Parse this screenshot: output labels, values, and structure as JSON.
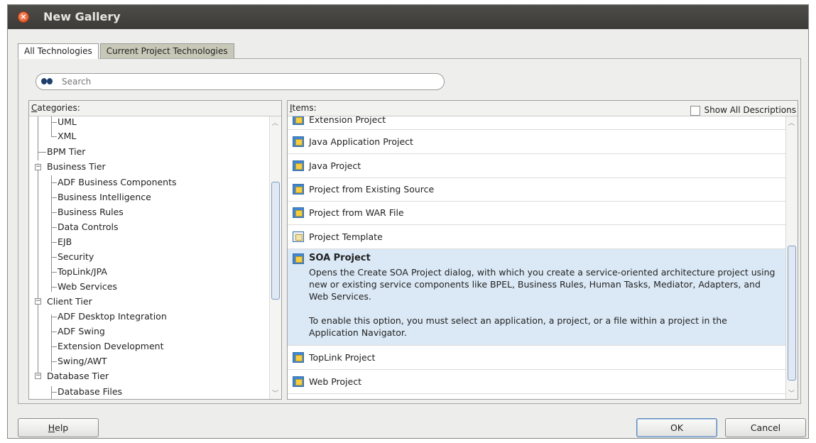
{
  "window": {
    "title": "New Gallery"
  },
  "tabs": [
    {
      "label": "All Technologies",
      "active": true
    },
    {
      "label": "Current Project Technologies",
      "active": false
    }
  ],
  "search": {
    "placeholder": "Search",
    "value": ""
  },
  "categories": {
    "header": "Categories:",
    "items": [
      {
        "label": "UML",
        "level": 1
      },
      {
        "label": "XML",
        "level": 1
      },
      {
        "label": "BPM Tier",
        "level": 0
      },
      {
        "label": "Business Tier",
        "level": 0,
        "expanded": true
      },
      {
        "label": "ADF Business Components",
        "level": 1
      },
      {
        "label": "Business Intelligence",
        "level": 1
      },
      {
        "label": "Business Rules",
        "level": 1
      },
      {
        "label": "Data Controls",
        "level": 1
      },
      {
        "label": "EJB",
        "level": 1
      },
      {
        "label": "Security",
        "level": 1
      },
      {
        "label": "TopLink/JPA",
        "level": 1
      },
      {
        "label": "Web Services",
        "level": 1
      },
      {
        "label": "Client Tier",
        "level": 0,
        "expanded": true
      },
      {
        "label": "ADF Desktop Integration",
        "level": 1
      },
      {
        "label": "ADF Swing",
        "level": 1
      },
      {
        "label": "Extension Development",
        "level": 1
      },
      {
        "label": "Swing/AWT",
        "level": 1
      },
      {
        "label": "Database Tier",
        "level": 0,
        "expanded": true
      },
      {
        "label": "Database Files",
        "level": 1
      }
    ]
  },
  "items_pane": {
    "header": "Items:",
    "show_all_label": "Show All Descriptions",
    "show_all_checked": false,
    "items": [
      {
        "label": "Extension Project",
        "icon": "project-icon"
      },
      {
        "label": "Java Application Project",
        "icon": "project-icon"
      },
      {
        "label": "Java Project",
        "icon": "project-icon"
      },
      {
        "label": "Project from Existing Source",
        "icon": "project-icon"
      },
      {
        "label": "Project from WAR File",
        "icon": "project-icon"
      },
      {
        "label": "Project Template",
        "icon": "project-template-icon"
      },
      {
        "label": "SOA Project",
        "icon": "project-icon",
        "selected": true,
        "description": [
          "Opens the Create SOA Project dialog, with which you create a service-oriented architecture project using new or existing service components like BPEL, Business Rules, Human Tasks, Mediator, Adapters, and Web Services.",
          "To enable this option, you must select an application, a project, or a file within a project in the Application Navigator."
        ]
      },
      {
        "label": "TopLink Project",
        "icon": "project-icon"
      },
      {
        "label": "Web Project",
        "icon": "project-icon"
      }
    ]
  },
  "buttons": {
    "help": "Help",
    "ok": "OK",
    "cancel": "Cancel"
  },
  "colors": {
    "titlebar": "#3c3b37",
    "selection": "#dbe9f6",
    "close": "#df4a16"
  }
}
